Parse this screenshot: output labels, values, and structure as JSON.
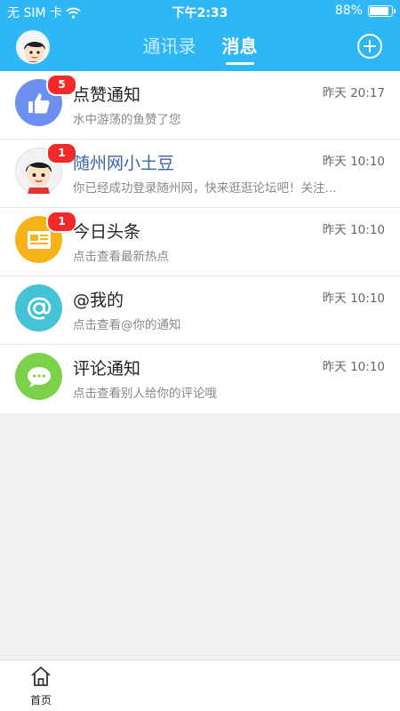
{
  "status_bar": {
    "carrier": "无 SIM 卡",
    "time": "下午2:33",
    "battery": "88%",
    "battery_level": 0.88
  },
  "nav": {
    "tabs": [
      {
        "label": "通讯录",
        "active": false
      },
      {
        "label": "消息",
        "active": true
      }
    ]
  },
  "messages": [
    {
      "title": "点赞通知",
      "time": "昨天 20:17",
      "preview": "水中游荡的鱼赞了您",
      "badge": "5",
      "icon": "thumbs-up-icon",
      "icon_color": "#6d8ff0"
    },
    {
      "title": "随州网小土豆",
      "time": "昨天 10:10",
      "preview": "你已经成功登录随州网，快来逛逛论坛吧！关注...",
      "badge": "1",
      "icon": "user-avatar",
      "icon_color": "#eeeeee"
    },
    {
      "title": "今日头条",
      "time": "昨天 10:10",
      "preview": "点击查看最新热点",
      "badge": "1",
      "icon": "newspaper-icon",
      "icon_color": "#f6b219"
    },
    {
      "title": "@我的",
      "time": "昨天 10:10",
      "preview": "点击查看@你的通知",
      "badge": "",
      "icon": "at-icon",
      "icon_color": "#45c3d6"
    },
    {
      "title": "评论通知",
      "time": "昨天 10:10",
      "preview": "点击查看别人给你的评论哦",
      "badge": "",
      "icon": "comment-icon",
      "icon_color": "#7bd24a"
    }
  ],
  "tabbar": {
    "home_label": "首页"
  }
}
